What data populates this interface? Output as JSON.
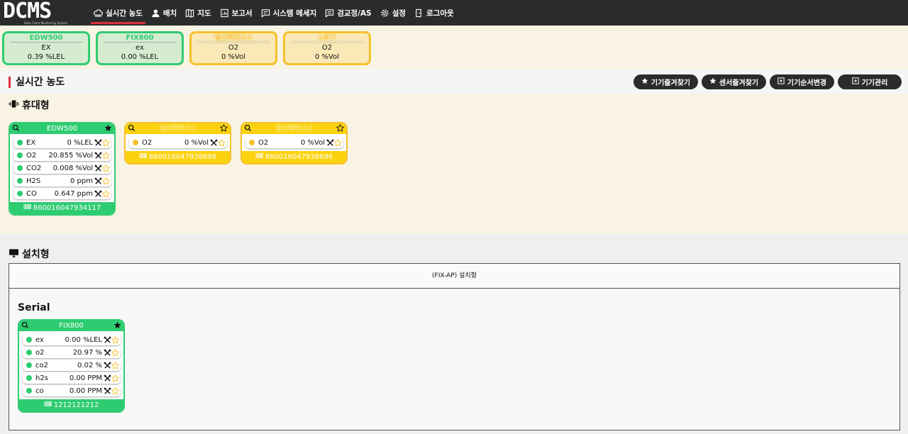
{
  "app": {
    "logo": "DCMS",
    "logo_sub": "Data Client Monitoring System"
  },
  "nav": [
    {
      "label": "실시간 농도",
      "icon": "cloud-icon",
      "active": true
    },
    {
      "label": "배치",
      "icon": "person-icon"
    },
    {
      "label": "지도",
      "icon": "map-icon"
    },
    {
      "label": "보고서",
      "icon": "report-icon"
    },
    {
      "label": "시스템 메세지",
      "icon": "message-icon"
    },
    {
      "label": "검교정/AS",
      "icon": "calibration-icon"
    },
    {
      "label": "설정",
      "icon": "gear-icon"
    },
    {
      "label": "로그아웃",
      "icon": "logout-icon"
    }
  ],
  "summary": [
    {
      "name": "EDW500",
      "sub": "EX",
      "value": "0.39 %LEL",
      "status": "green"
    },
    {
      "name": "FIX800",
      "sub": "ex",
      "value": "0.00 %LEL",
      "status": "green"
    },
    {
      "name": "일산화탄소1",
      "sub": "O2",
      "value": "0 %Vol",
      "status": "yellow"
    },
    {
      "name": "1호기",
      "sub": "O2",
      "value": "0 %Vol",
      "status": "yellow"
    }
  ],
  "section": {
    "title": "실시간 농도"
  },
  "buttons": {
    "device_fav": "기기즐겨찾기",
    "sensor_fav": "센서즐겨찾기",
    "device_order": "기기순서변경",
    "device_manage": "기기관리"
  },
  "portable": {
    "title": "휴대형",
    "devices": [
      {
        "name": "EDW500",
        "status": "green",
        "favorite": true,
        "serial": "860016047934117",
        "sensors": [
          {
            "name": "EX",
            "value": "0 %LEL"
          },
          {
            "name": "O2",
            "value": "20.855 %Vol"
          },
          {
            "name": "CO2",
            "value": "0.008 %Vol"
          },
          {
            "name": "H2S",
            "value": "0 ppm"
          },
          {
            "name": "CO",
            "value": "0.647 ppm"
          }
        ]
      },
      {
        "name": "일산화탄소1",
        "status": "yellow",
        "favorite": false,
        "serial": "860016047938696",
        "sensors": [
          {
            "name": "O2",
            "value": "0 %Vol"
          }
        ]
      },
      {
        "name": "일산화탄소2",
        "status": "yellow",
        "favorite": false,
        "serial": "860016047938696",
        "sensors": [
          {
            "name": "O2",
            "value": "0 %Vol"
          }
        ]
      }
    ]
  },
  "fixed": {
    "title": "설치형",
    "table_header": "(FIX-AP) 설치형",
    "serial_label": "Serial",
    "devices": [
      {
        "name": "FIX800",
        "status": "green",
        "favorite": true,
        "serial": "1212121212",
        "sensors": [
          {
            "name": "ex",
            "value": "0.00 %LEL"
          },
          {
            "name": "o2",
            "value": "20.97 %"
          },
          {
            "name": "co2",
            "value": "0.02 %"
          },
          {
            "name": "h2s",
            "value": "0.00 PPM"
          },
          {
            "name": "co",
            "value": "0.00 PPM"
          }
        ]
      }
    ]
  },
  "colors": {
    "green": "#2ecc71",
    "yellow": "#f7c02c",
    "dark": "#2b2b2b",
    "accent": "#e0303e"
  }
}
